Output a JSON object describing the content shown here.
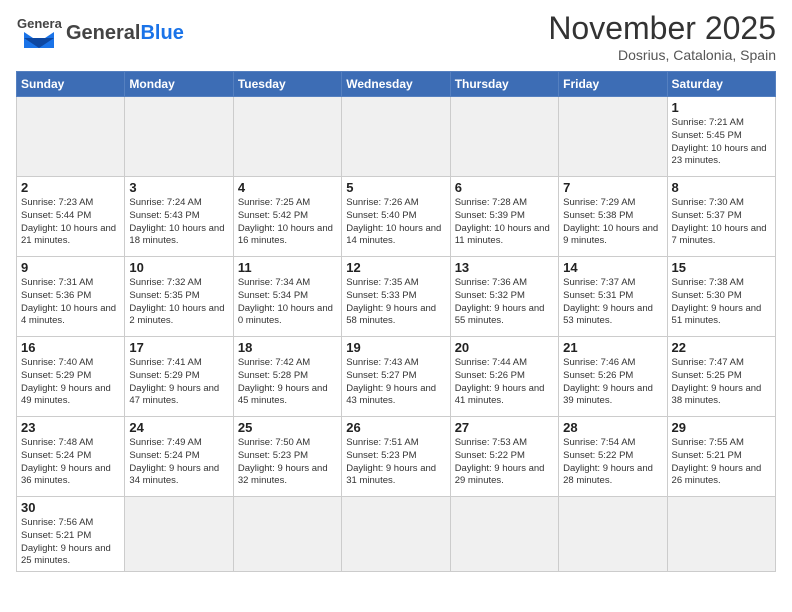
{
  "logo": {
    "text_general": "General",
    "text_blue": "Blue"
  },
  "title": "November 2025",
  "location": "Dosrius, Catalonia, Spain",
  "weekdays": [
    "Sunday",
    "Monday",
    "Tuesday",
    "Wednesday",
    "Thursday",
    "Friday",
    "Saturday"
  ],
  "weeks": [
    [
      {
        "day": "",
        "info": ""
      },
      {
        "day": "",
        "info": ""
      },
      {
        "day": "",
        "info": ""
      },
      {
        "day": "",
        "info": ""
      },
      {
        "day": "",
        "info": ""
      },
      {
        "day": "",
        "info": ""
      },
      {
        "day": "1",
        "info": "Sunrise: 7:21 AM\nSunset: 5:45 PM\nDaylight: 10 hours and 23 minutes."
      }
    ],
    [
      {
        "day": "2",
        "info": "Sunrise: 7:23 AM\nSunset: 5:44 PM\nDaylight: 10 hours and 21 minutes."
      },
      {
        "day": "3",
        "info": "Sunrise: 7:24 AM\nSunset: 5:43 PM\nDaylight: 10 hours and 18 minutes."
      },
      {
        "day": "4",
        "info": "Sunrise: 7:25 AM\nSunset: 5:42 PM\nDaylight: 10 hours and 16 minutes."
      },
      {
        "day": "5",
        "info": "Sunrise: 7:26 AM\nSunset: 5:40 PM\nDaylight: 10 hours and 14 minutes."
      },
      {
        "day": "6",
        "info": "Sunrise: 7:28 AM\nSunset: 5:39 PM\nDaylight: 10 hours and 11 minutes."
      },
      {
        "day": "7",
        "info": "Sunrise: 7:29 AM\nSunset: 5:38 PM\nDaylight: 10 hours and 9 minutes."
      },
      {
        "day": "8",
        "info": "Sunrise: 7:30 AM\nSunset: 5:37 PM\nDaylight: 10 hours and 7 minutes."
      }
    ],
    [
      {
        "day": "9",
        "info": "Sunrise: 7:31 AM\nSunset: 5:36 PM\nDaylight: 10 hours and 4 minutes."
      },
      {
        "day": "10",
        "info": "Sunrise: 7:32 AM\nSunset: 5:35 PM\nDaylight: 10 hours and 2 minutes."
      },
      {
        "day": "11",
        "info": "Sunrise: 7:34 AM\nSunset: 5:34 PM\nDaylight: 10 hours and 0 minutes."
      },
      {
        "day": "12",
        "info": "Sunrise: 7:35 AM\nSunset: 5:33 PM\nDaylight: 9 hours and 58 minutes."
      },
      {
        "day": "13",
        "info": "Sunrise: 7:36 AM\nSunset: 5:32 PM\nDaylight: 9 hours and 55 minutes."
      },
      {
        "day": "14",
        "info": "Sunrise: 7:37 AM\nSunset: 5:31 PM\nDaylight: 9 hours and 53 minutes."
      },
      {
        "day": "15",
        "info": "Sunrise: 7:38 AM\nSunset: 5:30 PM\nDaylight: 9 hours and 51 minutes."
      }
    ],
    [
      {
        "day": "16",
        "info": "Sunrise: 7:40 AM\nSunset: 5:29 PM\nDaylight: 9 hours and 49 minutes."
      },
      {
        "day": "17",
        "info": "Sunrise: 7:41 AM\nSunset: 5:29 PM\nDaylight: 9 hours and 47 minutes."
      },
      {
        "day": "18",
        "info": "Sunrise: 7:42 AM\nSunset: 5:28 PM\nDaylight: 9 hours and 45 minutes."
      },
      {
        "day": "19",
        "info": "Sunrise: 7:43 AM\nSunset: 5:27 PM\nDaylight: 9 hours and 43 minutes."
      },
      {
        "day": "20",
        "info": "Sunrise: 7:44 AM\nSunset: 5:26 PM\nDaylight: 9 hours and 41 minutes."
      },
      {
        "day": "21",
        "info": "Sunrise: 7:46 AM\nSunset: 5:26 PM\nDaylight: 9 hours and 39 minutes."
      },
      {
        "day": "22",
        "info": "Sunrise: 7:47 AM\nSunset: 5:25 PM\nDaylight: 9 hours and 38 minutes."
      }
    ],
    [
      {
        "day": "23",
        "info": "Sunrise: 7:48 AM\nSunset: 5:24 PM\nDaylight: 9 hours and 36 minutes."
      },
      {
        "day": "24",
        "info": "Sunrise: 7:49 AM\nSunset: 5:24 PM\nDaylight: 9 hours and 34 minutes."
      },
      {
        "day": "25",
        "info": "Sunrise: 7:50 AM\nSunset: 5:23 PM\nDaylight: 9 hours and 32 minutes."
      },
      {
        "day": "26",
        "info": "Sunrise: 7:51 AM\nSunset: 5:23 PM\nDaylight: 9 hours and 31 minutes."
      },
      {
        "day": "27",
        "info": "Sunrise: 7:53 AM\nSunset: 5:22 PM\nDaylight: 9 hours and 29 minutes."
      },
      {
        "day": "28",
        "info": "Sunrise: 7:54 AM\nSunset: 5:22 PM\nDaylight: 9 hours and 28 minutes."
      },
      {
        "day": "29",
        "info": "Sunrise: 7:55 AM\nSunset: 5:21 PM\nDaylight: 9 hours and 26 minutes."
      }
    ],
    [
      {
        "day": "30",
        "info": "Sunrise: 7:56 AM\nSunset: 5:21 PM\nDaylight: 9 hours and 25 minutes."
      },
      {
        "day": "",
        "info": ""
      },
      {
        "day": "",
        "info": ""
      },
      {
        "day": "",
        "info": ""
      },
      {
        "day": "",
        "info": ""
      },
      {
        "day": "",
        "info": ""
      },
      {
        "day": "",
        "info": ""
      }
    ]
  ]
}
